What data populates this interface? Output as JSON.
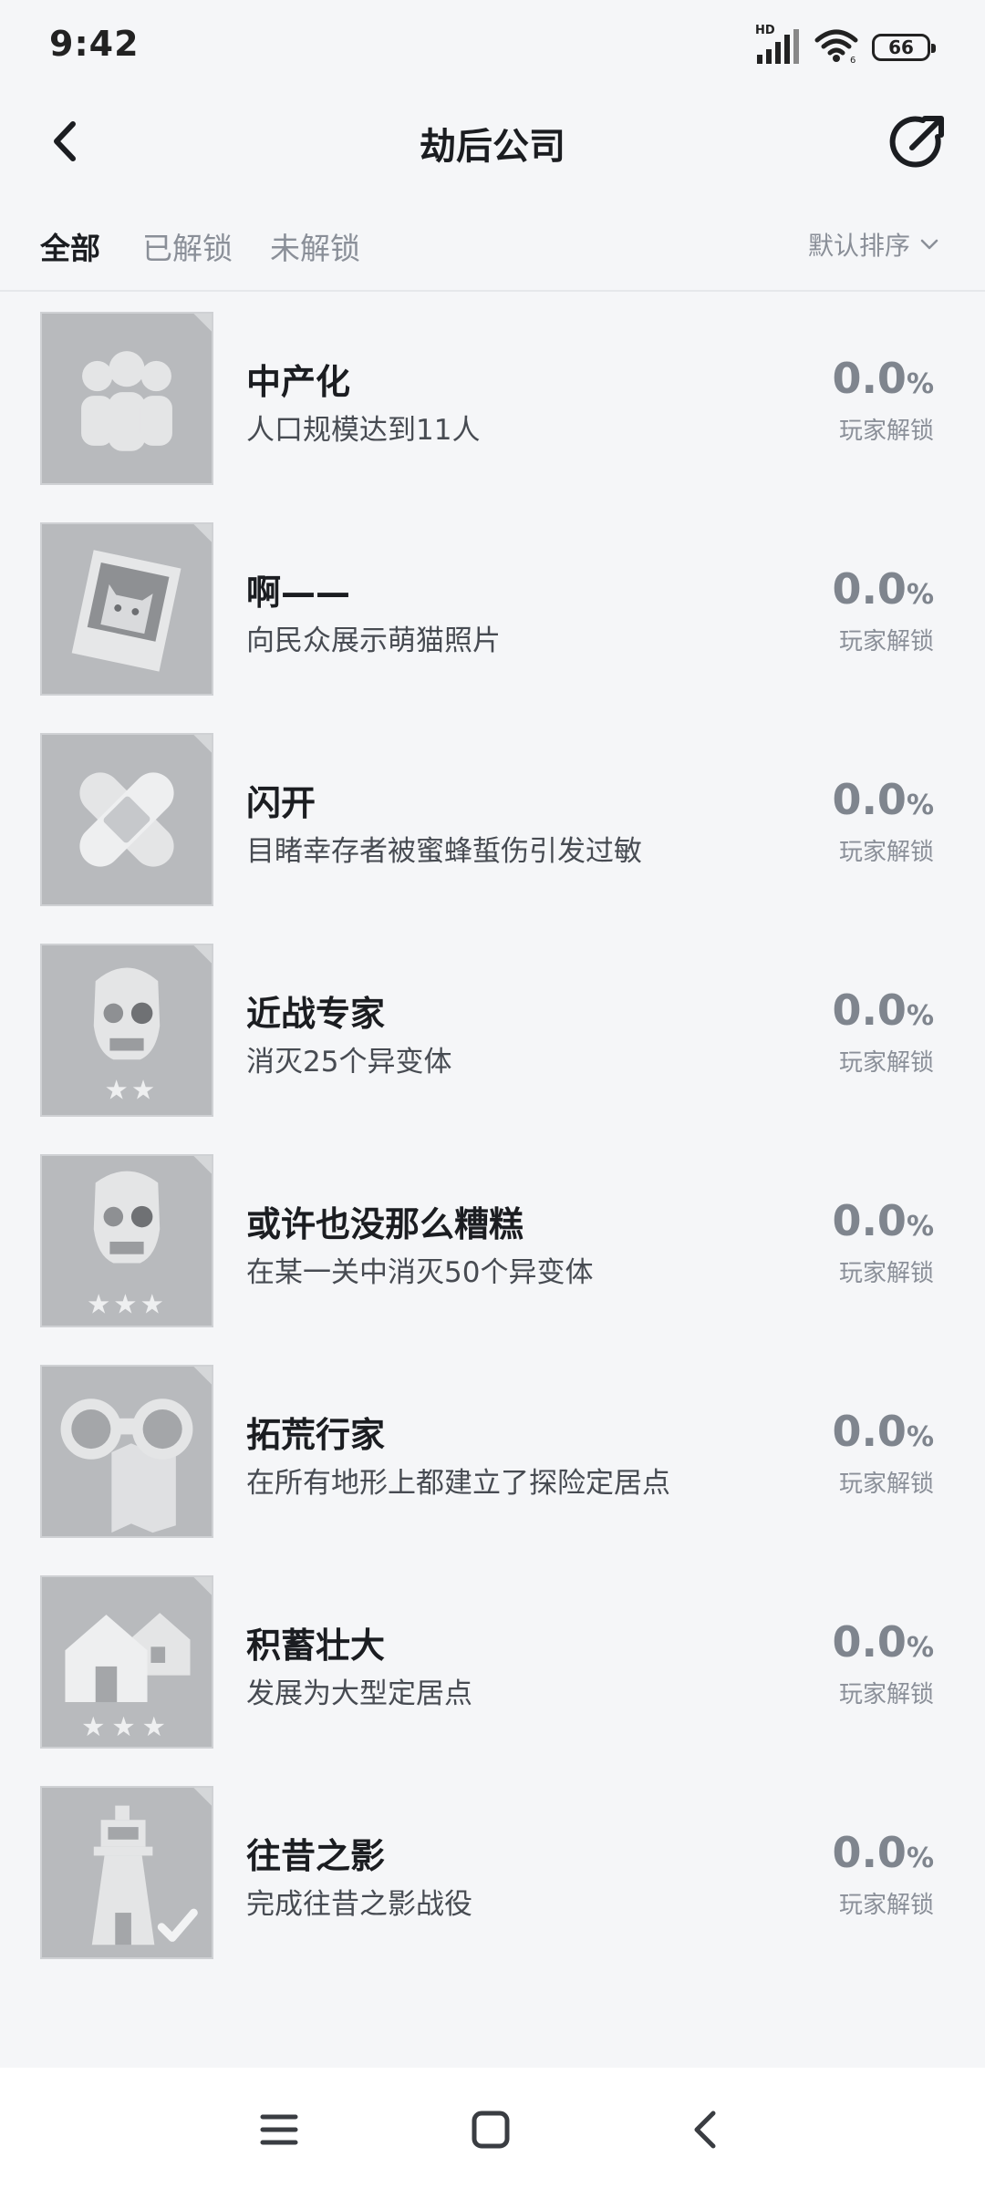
{
  "status_bar": {
    "time": "9:42",
    "signal_badge": "HD",
    "battery_level": "66",
    "icons": [
      "signal-icon",
      "wifi-icon",
      "battery-icon"
    ]
  },
  "header": {
    "title": "劫后公司",
    "back_icon": "chevron-left-icon",
    "share_icon": "share-icon"
  },
  "tabs": [
    {
      "label": "全部",
      "active": true
    },
    {
      "label": "已解锁",
      "active": false
    },
    {
      "label": "未解锁",
      "active": false
    }
  ],
  "sort": {
    "label": "默认排序",
    "icon": "chevron-down-icon"
  },
  "achievements": [
    {
      "title": "中产化",
      "desc": "人口规模达到11人",
      "pct": "0.0",
      "unit": "%",
      "sub": "玩家解锁",
      "icon": "people-icon"
    },
    {
      "title": "啊——",
      "desc": "向民众展示萌猫照片",
      "pct": "0.0",
      "unit": "%",
      "sub": "玩家解锁",
      "icon": "cat-photo-icon"
    },
    {
      "title": "闪开",
      "desc": "目睹幸存者被蜜蜂蜇伤引发过敏",
      "pct": "0.0",
      "unit": "%",
      "sub": "玩家解锁",
      "icon": "bandage-icon"
    },
    {
      "title": "近战专家",
      "desc": "消灭25个异变体",
      "pct": "0.0",
      "unit": "%",
      "sub": "玩家解锁",
      "icon": "zombie-two-stars-icon"
    },
    {
      "title": "或许也没那么糟糕",
      "desc": "在某一关中消灭50个异变体",
      "pct": "0.0",
      "unit": "%",
      "sub": "玩家解锁",
      "icon": "zombie-three-stars-icon"
    },
    {
      "title": "拓荒行家",
      "desc": "在所有地形上都建立了探险定居点",
      "pct": "0.0",
      "unit": "%",
      "sub": "玩家解锁",
      "icon": "binoculars-map-icon"
    },
    {
      "title": "积蓄壮大",
      "desc": "发展为大型定居点",
      "pct": "0.0",
      "unit": "%",
      "sub": "玩家解锁",
      "icon": "houses-three-stars-icon"
    },
    {
      "title": "往昔之影",
      "desc": "完成往昔之影战役",
      "pct": "0.0",
      "unit": "%",
      "sub": "玩家解锁",
      "icon": "lighthouse-check-icon"
    }
  ],
  "nav_bar": {
    "icons": [
      "menu-icon",
      "home-square-icon",
      "back-triangle-icon"
    ]
  }
}
